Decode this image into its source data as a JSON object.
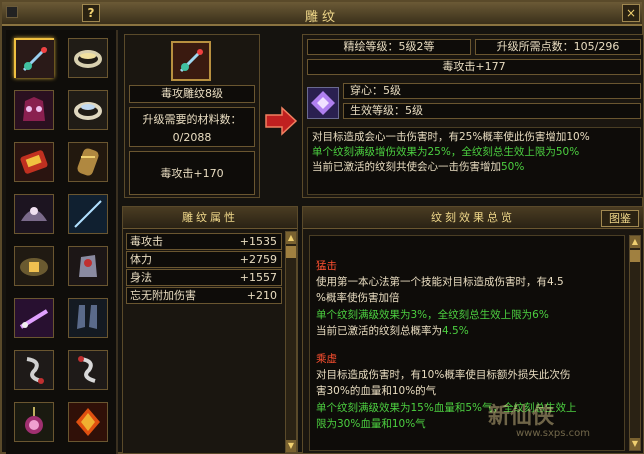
{
  "window": {
    "title": "雕纹",
    "help": "?",
    "close": "×"
  },
  "carve": {
    "name": "毒攻雕纹8级",
    "material_label": "升级需要的材料数：",
    "material_value": "0/2088",
    "current_attr": "毒攻击+170"
  },
  "upgrade": {
    "refine_level": "精绘等级：5级2等",
    "points_needed": "升级所需点数：105/296",
    "next_attr": "毒攻击+177",
    "slot_label": "穿心：5级",
    "effect_level": "生效等级：5级",
    "desc_line1": "对目标造成会心一击伤害时，有25%概率使此伤害增加10%",
    "desc_line2": "单个纹刻满级增伤效果为25%，全纹刻总生效上限为50%",
    "desc_line3_a": "当前已激活的纹刻共使会心一击伤害增加",
    "desc_line3_b": "50%"
  },
  "props": {
    "title": "雕纹属性",
    "rows": [
      {
        "label": "毒攻击",
        "value": "+1535"
      },
      {
        "label": "体力",
        "value": "+2759"
      },
      {
        "label": "身法",
        "value": "+1557"
      },
      {
        "label": "忘无附加伤害",
        "value": "+210"
      }
    ]
  },
  "effects": {
    "title": "纹刻效果总览",
    "atlas_button": "图鉴",
    "items": [
      {
        "name": "猛击",
        "l1": "使用第一本心法第一个技能对目标造成伤害时，有4.5",
        "l2": "%概率使伤害加倍",
        "l3": "单个纹刻满级效果为3%，全纹刻总生效上限为6%",
        "l4a": "当前已激活的纹刻总概率为",
        "l4b": "4.5%"
      },
      {
        "name": "乘虚",
        "l1": "对目标造成伤害时，有10%概率使目标额外损失此次伤",
        "l2": "害30%的血量和10%的气",
        "l3": "单个纹刻满级效果为15%血量和5%气，全纹刻总生效上",
        "l4": "限为30%血量和10%气"
      }
    ]
  },
  "watermark": {
    "brand": "新仙侠",
    "url": "www.sxps.com"
  },
  "colors": {
    "gold": "#f0d88a",
    "green": "#4cd040",
    "red": "#ff5030",
    "border": "#6a5630"
  },
  "slot_icons": [
    "sword-icon",
    "ring-icon",
    "mask-icon",
    "ring-icon",
    "scroll-icon",
    "bracer-icon",
    "helmet-icon",
    "blade-icon",
    "belt-icon",
    "gauntlet-icon",
    "dagger-icon",
    "boots-icon",
    "charm-icon",
    "charm-icon",
    "amulet-icon",
    "gem-icon"
  ]
}
